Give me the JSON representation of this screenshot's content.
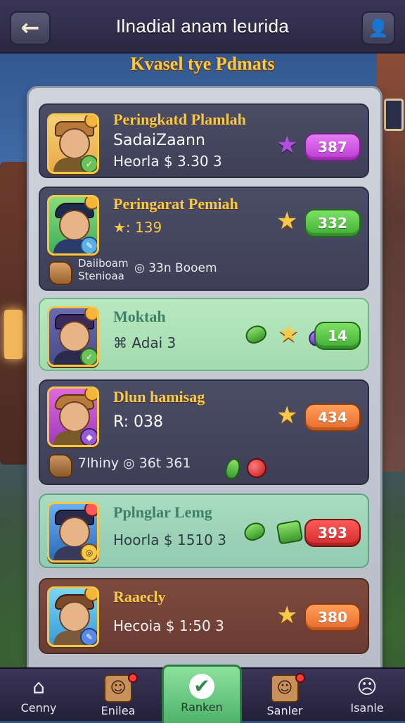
{
  "header": {
    "title": "Ilnadial anam leurida",
    "subtitle": "Kvasel tye Pdmats"
  },
  "colors": {
    "accent_gold": "#f7c94a",
    "pill_purple": "#c94ee0",
    "pill_green": "#4cbc3c",
    "pill_orange": "#f07a34",
    "pill_red": "#de2e2e"
  },
  "cards": [
    {
      "style": "dark",
      "title": "Peringkatd Plamlah",
      "line1": "SadaiZaann",
      "line2": "Heorla $ 3.30 3",
      "icon": "purple-star-icon",
      "pill_color": "purple",
      "pill_value": "387"
    },
    {
      "style": "dark",
      "title": "Peringarat Pemiah",
      "line1": "★: 139",
      "line2a": "Daiiboam",
      "line2b": "Stenioaa",
      "line2c": "◎ 33n Booem",
      "icon": "gold-star-icon",
      "pill_color": "green",
      "pill_value": "332"
    },
    {
      "style": "green",
      "title": "Moktah",
      "line1": "⌘ Adai 3",
      "icon": "gold-star-icon",
      "pill_color": "green",
      "pill_value": "14"
    },
    {
      "style": "dark",
      "title": "Dlun hamisag",
      "line1": "R: 038",
      "line2": "7lhiny ◎ 36t 361",
      "icon": "gold-star-icon",
      "pill_color": "orange",
      "pill_value": "434"
    },
    {
      "style": "teal",
      "title": "Pplnglar Lemg",
      "line1": "Hoorla $ 1510 3",
      "icon": "green-gem-icon",
      "pill_color": "red",
      "pill_value": "393"
    },
    {
      "style": "brown",
      "title": "Raaecly",
      "line1": "Hecoia $ 1:50 3",
      "icon": "gold-star-icon",
      "pill_color": "orange",
      "pill_value": "380"
    }
  ],
  "nav": [
    {
      "label": "Cenny",
      "icon": "home-icon"
    },
    {
      "label": "Enilea",
      "icon": "character-icon"
    },
    {
      "label": "Ranken",
      "icon": "rank-badge-icon",
      "active": true
    },
    {
      "label": "Sanler",
      "icon": "character-icon"
    },
    {
      "label": "Isanle",
      "icon": "mask-icon"
    }
  ]
}
